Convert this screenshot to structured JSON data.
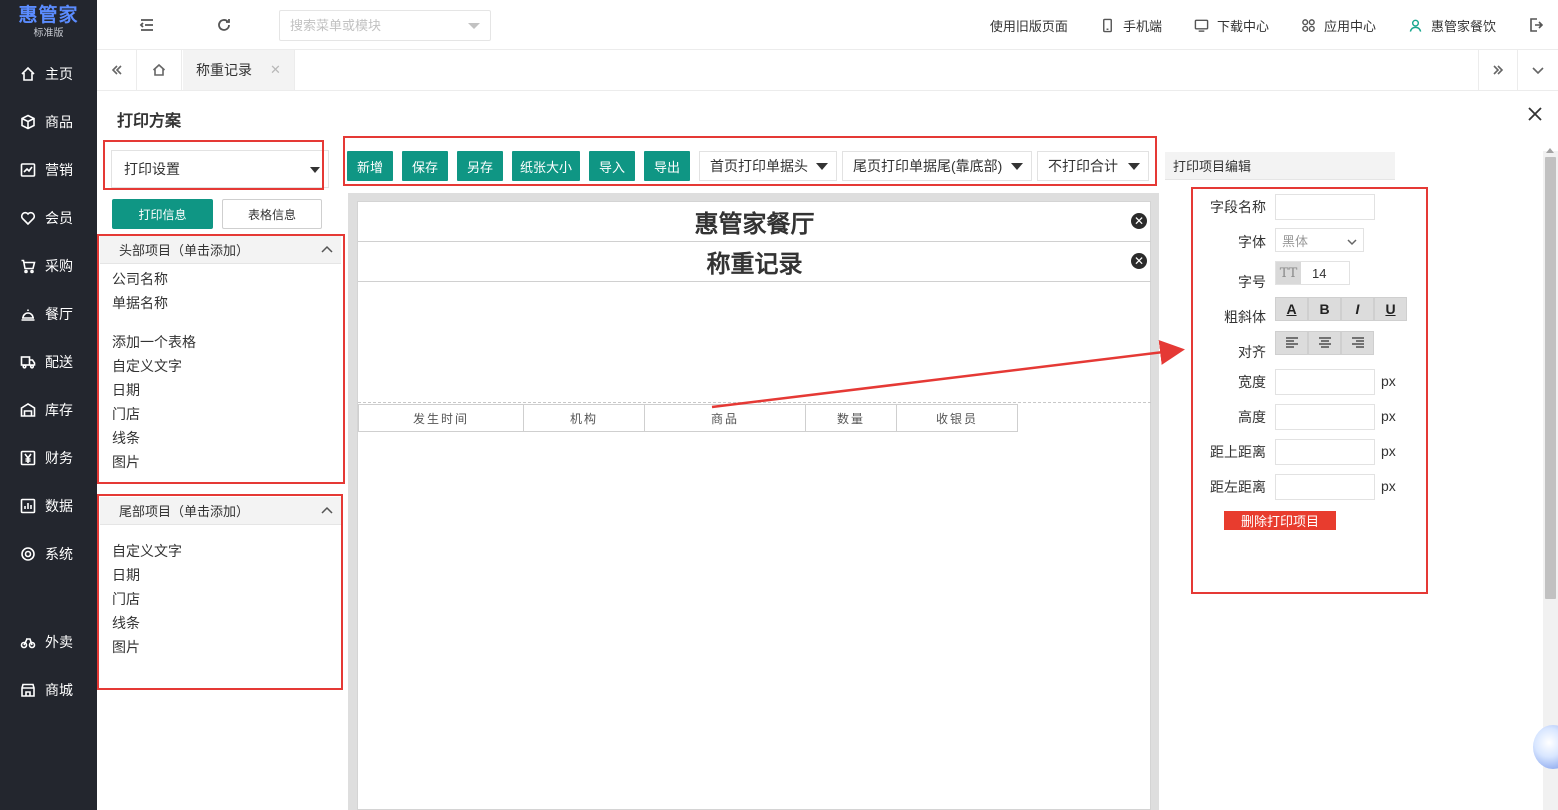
{
  "logo": {
    "name": "惠管家",
    "edition": "标准版"
  },
  "sidebar": {
    "items": [
      {
        "label": "主页",
        "icon": "home-icon"
      },
      {
        "label": "商品",
        "icon": "box-icon"
      },
      {
        "label": "营销",
        "icon": "chart-icon"
      },
      {
        "label": "会员",
        "icon": "heart-icon"
      },
      {
        "label": "采购",
        "icon": "cart-icon"
      },
      {
        "label": "餐厅",
        "icon": "cloche-icon"
      },
      {
        "label": "配送",
        "icon": "truck-icon"
      },
      {
        "label": "库存",
        "icon": "warehouse-icon"
      },
      {
        "label": "财务",
        "icon": "yuan-icon"
      },
      {
        "label": "数据",
        "icon": "bar-chart-icon"
      },
      {
        "label": "系统",
        "icon": "settings-icon"
      }
    ],
    "extra_items": [
      {
        "label": "外卖",
        "icon": "takeout-icon"
      },
      {
        "label": "商城",
        "icon": "store-icon"
      }
    ]
  },
  "topbar": {
    "search_placeholder": "搜索菜单或模块",
    "old_version": "使用旧版页面",
    "mobile": "手机端",
    "download": "下载中心",
    "apps": "应用中心",
    "user": "惠管家餐饮"
  },
  "tabs": {
    "active": "称重记录"
  },
  "panel": {
    "title": "打印方案"
  },
  "left": {
    "setting_select": "打印设置",
    "print_info_btn": "打印信息",
    "table_info_btn": "表格信息",
    "header_group": {
      "title": "头部项目（单击添加）",
      "items_a": [
        "公司名称",
        "单据名称"
      ],
      "items_b": [
        "添加一个表格",
        "自定义文字",
        "日期",
        "门店",
        "线条",
        "图片"
      ]
    },
    "footer_group": {
      "title": "尾部项目（单击添加）",
      "items": [
        "自定义文字",
        "日期",
        "门店",
        "线条",
        "图片"
      ]
    }
  },
  "toolbar": {
    "buttons": [
      "新增",
      "保存",
      "另存",
      "纸张大小",
      "导入",
      "导出"
    ],
    "dropdowns": [
      "首页打印单据头",
      "尾页打印单据尾(靠底部)",
      "不打印合计"
    ]
  },
  "canvas": {
    "header_lines": [
      "惠管家餐厅",
      "称重记录"
    ],
    "columns": [
      "发生时间",
      "机构",
      "商品",
      "数量",
      "收银员"
    ]
  },
  "editor": {
    "title": "打印项目编辑",
    "labels": {
      "field_name": "字段名称",
      "font": "字体",
      "font_size": "字号",
      "style": "粗斜体",
      "align": "对齐",
      "width": "宽度",
      "height": "高度",
      "top": "距上距离",
      "left": "距左距离"
    },
    "font_value": "黑体",
    "font_size_icon": "TT",
    "font_size_value": "14",
    "style_buttons": [
      "A",
      "B",
      "I",
      "U"
    ],
    "unit": "px",
    "delete_btn": "删除打印项目"
  },
  "colors": {
    "primary": "#0f9684",
    "sidebar_bg": "#23262e",
    "highlight": "#e53935",
    "danger": "#e83c2e"
  }
}
